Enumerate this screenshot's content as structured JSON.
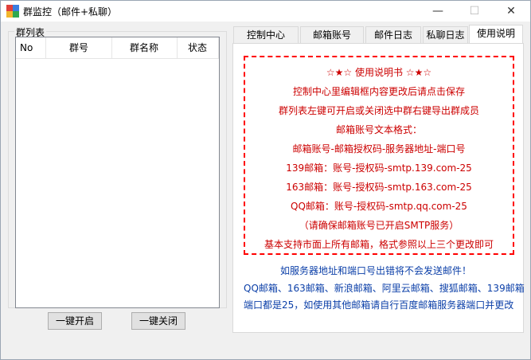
{
  "window": {
    "title": "群监控（邮件+私聊）"
  },
  "controls": {
    "minimize": "—",
    "maximize": "☐",
    "close": "✕"
  },
  "group_list": {
    "title": "群列表",
    "columns": [
      "No",
      "群号",
      "群名称",
      "状态"
    ]
  },
  "buttons": {
    "start": "一键开启",
    "stop": "一键关闭"
  },
  "tabs": [
    "控制中心",
    "邮箱账号",
    "邮件日志",
    "私聊日志",
    "使用说明"
  ],
  "instructions": {
    "heading": "☆★☆  使用说明书  ☆★☆",
    "lines": [
      "控制中心里编辑框内容更改后请点击保存",
      "群列表左键可开启或关闭选中群右键导出群成员",
      "邮箱账号文本格式：",
      "邮箱账号-邮箱授权码-服务器地址-端口号",
      "139邮箱：账号-授权码-smtp.139.com-25",
      "163邮箱：账号-授权码-smtp.163.com-25",
      "QQ邮箱：账号-授权码-smtp.qq.com-25",
      "（请确保邮箱账号已开启SMTP服务）",
      "基本支持市面上所有邮箱，格式参照以上三个更改即可"
    ],
    "footer": [
      "如服务器地址和端口号出错将不会发送邮件！",
      "QQ邮箱、163邮箱、新浪邮箱、阿里云邮箱、搜狐邮箱、139邮箱",
      "端口都是25，如使用其他邮箱请自行百度邮箱服务器端口并更改"
    ]
  }
}
